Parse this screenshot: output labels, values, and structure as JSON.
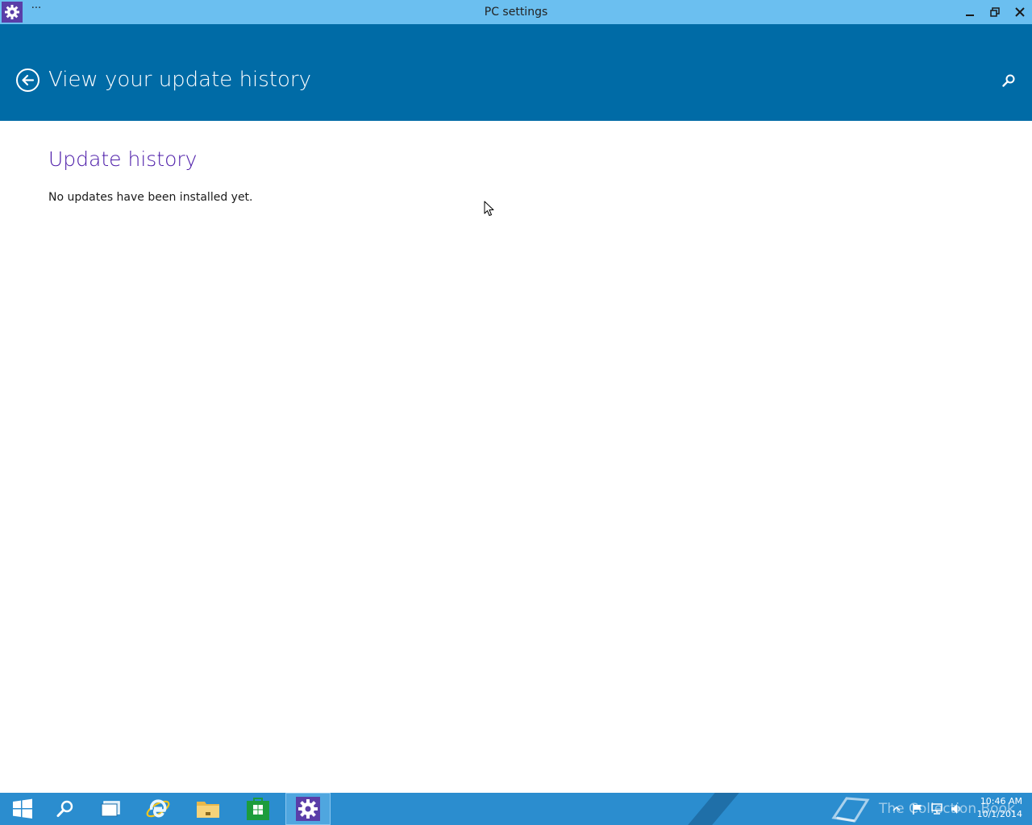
{
  "window": {
    "title": "PC settings",
    "more_label": "···"
  },
  "header": {
    "title": "View your update history"
  },
  "content": {
    "section_title": "Update history",
    "empty_message": "No updates have been installed yet."
  },
  "taskbar": {
    "pinned": [
      {
        "name": "start",
        "icon": "windows-logo-icon"
      },
      {
        "name": "search",
        "icon": "search-icon"
      },
      {
        "name": "task-view",
        "icon": "task-view-icon"
      },
      {
        "name": "internet-explorer",
        "icon": "internet-explorer-icon"
      },
      {
        "name": "file-explorer",
        "icon": "folder-icon"
      },
      {
        "name": "store",
        "icon": "store-icon"
      },
      {
        "name": "pc-settings",
        "icon": "gear-icon",
        "active": true
      }
    ],
    "watermark_text": "The Collection Book",
    "clock": {
      "time": "10:46 AM",
      "date": "10/1/2014"
    }
  },
  "colors": {
    "titlebar": "#6bbff0",
    "header": "#006ba6",
    "section_title": "#4b1aa8",
    "taskbar": "#2b8dcf",
    "app_icon_bg": "#5a3ea8"
  }
}
